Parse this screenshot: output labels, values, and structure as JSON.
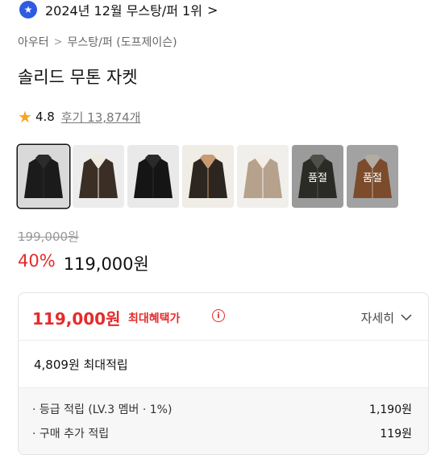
{
  "rank": {
    "text": "2024년 12월 무스탕/퍼 1위",
    "chevron": ">",
    "badge_icon": "star-badge-icon",
    "badge_color": "#2f5be0"
  },
  "breadcrumb": [
    "아우터",
    "무스탕/퍼 (도프제이슨)"
  ],
  "breadcrumb_sep": ">",
  "product": {
    "title": "솔리드 무톤 자켓"
  },
  "rating": {
    "score": "4.8",
    "reviews": "후기 13,874개",
    "star_color": "#f5a623"
  },
  "thumbnails": [
    {
      "label": "",
      "colors": [
        "#1b1b1b",
        "#2b2b2b",
        "#d9d9d9"
      ]
    },
    {
      "label": "",
      "colors": [
        "#3a2e25",
        "#efe9e0",
        "#ececec"
      ]
    },
    {
      "label": "",
      "colors": [
        "#151515",
        "#2a2a2a",
        "#e9e9e9"
      ]
    },
    {
      "label": "",
      "colors": [
        "#2d2620",
        "#c89a72",
        "#f0ece6"
      ]
    },
    {
      "label": "",
      "colors": [
        "#b5a18c",
        "#f3ede5",
        "#f1efec"
      ]
    },
    {
      "label": "품절",
      "colors": [
        "#3a3a33",
        "#6b6a60",
        "#cfcfcf"
      ]
    },
    {
      "label": "품절",
      "colors": [
        "#a4643a",
        "#f0e6da",
        "#d8d8d8"
      ]
    }
  ],
  "price": {
    "original": "199,000원",
    "discount": "40%",
    "sale": "119,000원",
    "accent": "#e52b2b"
  },
  "benefit": {
    "max_price": "119,000원",
    "max_label": "최대혜택가",
    "info_icon": "info-circle-icon",
    "detail_label": "자세히",
    "max_points": "4,809원 최대적립",
    "items": [
      {
        "label": "· 등급 적립 (LV.3 멤버 · 1%)",
        "value": "1,190원"
      },
      {
        "label": "· 구매 추가 적립",
        "value": "119원"
      }
    ]
  }
}
